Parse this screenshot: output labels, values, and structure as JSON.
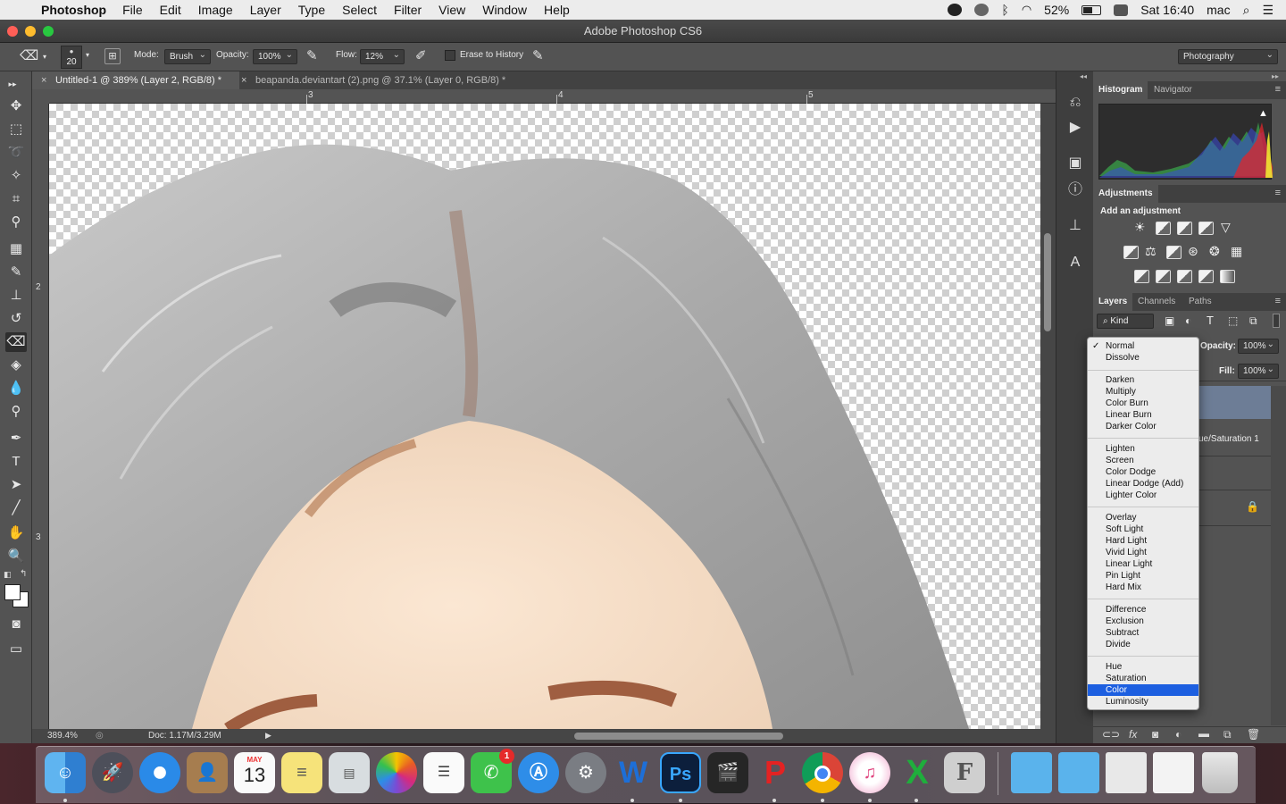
{
  "menubar": {
    "app_name": "Photoshop",
    "items": [
      "File",
      "Edit",
      "Image",
      "Layer",
      "Type",
      "Select",
      "Filter",
      "View",
      "Window",
      "Help"
    ],
    "battery": "52%",
    "clock": "Sat 16:40",
    "user": "mac"
  },
  "window": {
    "title": "Adobe Photoshop CS6"
  },
  "options": {
    "brush_size": "20",
    "mode_label": "Mode:",
    "mode_value": "Brush",
    "opacity_label": "Opacity:",
    "opacity_value": "100%",
    "flow_label": "Flow:",
    "flow_value": "12%",
    "erase_history_label": "Erase to History",
    "workspace": "Photography"
  },
  "tabs": [
    {
      "label": "Untitled-1 @ 389% (Layer 2, RGB/8) *"
    },
    {
      "label": "beapanda.deviantart (2).png @ 37.1% (Layer 0, RGB/8) *"
    }
  ],
  "rulers": {
    "h_ticks": [
      "3",
      "4",
      "5"
    ],
    "v_ticks": [
      "2",
      "3"
    ]
  },
  "status": {
    "zoom": "389.4%",
    "doc": "Doc: 1.17M/3.29M"
  },
  "panels": {
    "histogram_tab": "Histogram",
    "navigator_tab": "Navigator",
    "adjustments_tab": "Adjustments",
    "add_adjustment": "Add an adjustment",
    "layers_tab": "Layers",
    "channels_tab": "Channels",
    "paths_tab": "Paths",
    "kind_label": "Kind",
    "opacity_label": "Opacity:",
    "opacity_value": "100%",
    "fill_label": "Fill:",
    "fill_value": "100%",
    "layer_partial_name": "ue/Saturation 1"
  },
  "blend_modes": {
    "groups": [
      [
        "Normal",
        "Dissolve"
      ],
      [
        "Darken",
        "Multiply",
        "Color Burn",
        "Linear Burn",
        "Darker Color"
      ],
      [
        "Lighten",
        "Screen",
        "Color Dodge",
        "Linear Dodge (Add)",
        "Lighter Color"
      ],
      [
        "Overlay",
        "Soft Light",
        "Hard Light",
        "Vivid Light",
        "Linear Light",
        "Pin Light",
        "Hard Mix"
      ],
      [
        "Difference",
        "Exclusion",
        "Subtract",
        "Divide"
      ],
      [
        "Hue",
        "Saturation",
        "Color",
        "Luminosity"
      ]
    ],
    "checked": "Normal",
    "selected": "Color"
  },
  "dock": {
    "calendar_month": "MAY",
    "calendar_day": "13",
    "facetime_badge": "1",
    "word_letter": "W",
    "ps_letters": "Ps",
    "excel_letter": "X",
    "font_letter": "F"
  }
}
